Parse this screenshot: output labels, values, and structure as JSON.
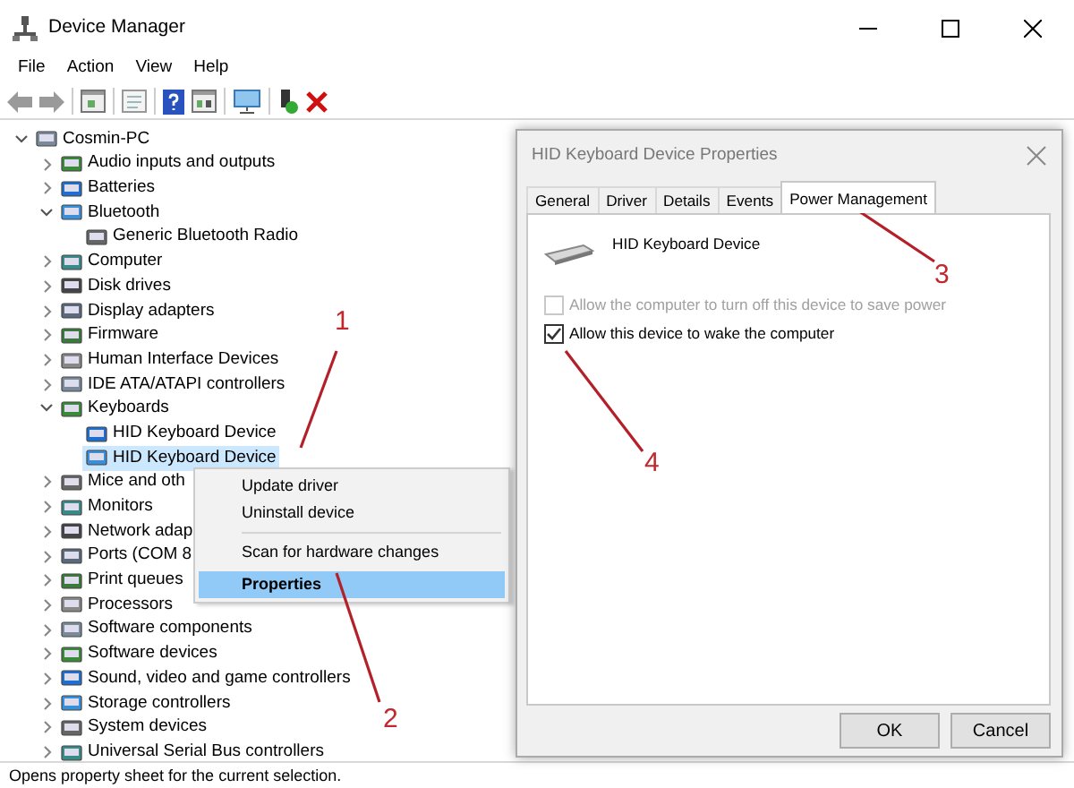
{
  "window": {
    "title": "Device Manager"
  },
  "menu": [
    "File",
    "Action",
    "View",
    "Help"
  ],
  "tree": {
    "label": "Cosmin-PC",
    "expanded": true,
    "selected": false,
    "children": [
      {
        "label": "Audio inputs and outputs",
        "expanded": false,
        "selected": false
      },
      {
        "label": "Batteries",
        "expanded": false,
        "selected": false
      },
      {
        "label": "Bluetooth",
        "expanded": true,
        "selected": false,
        "children": [
          {
            "label": "Generic Bluetooth Radio",
            "selected": false
          }
        ]
      },
      {
        "label": "Computer",
        "expanded": false,
        "selected": false
      },
      {
        "label": "Disk drives",
        "expanded": false,
        "selected": false
      },
      {
        "label": "Display adapters",
        "expanded": false,
        "selected": false
      },
      {
        "label": "Firmware",
        "expanded": false,
        "selected": false
      },
      {
        "label": "Human Interface Devices",
        "expanded": false,
        "selected": false
      },
      {
        "label": "IDE ATA/ATAPI controllers",
        "expanded": false,
        "selected": false
      },
      {
        "label": "Keyboards",
        "expanded": true,
        "selected": false,
        "children": [
          {
            "label": "HID Keyboard Device",
            "selected": false
          },
          {
            "label": "HID Keyboard Device",
            "selected": true
          }
        ]
      },
      {
        "label": "Mice and oth",
        "expanded": false,
        "selected": false
      },
      {
        "label": "Monitors",
        "expanded": false,
        "selected": false
      },
      {
        "label": "Network adap",
        "expanded": false,
        "selected": false
      },
      {
        "label": "Ports (COM 8",
        "expanded": false,
        "selected": false
      },
      {
        "label": "Print queues",
        "expanded": false,
        "selected": false
      },
      {
        "label": "Processors",
        "expanded": false,
        "selected": false
      },
      {
        "label": "Software components",
        "expanded": false,
        "selected": false
      },
      {
        "label": "Software devices",
        "expanded": false,
        "selected": false
      },
      {
        "label": "Sound, video and game controllers",
        "expanded": false,
        "selected": false
      },
      {
        "label": "Storage controllers",
        "expanded": false,
        "selected": false
      },
      {
        "label": "System devices",
        "expanded": false,
        "selected": false
      },
      {
        "label": "Universal Serial Bus controllers",
        "expanded": false,
        "selected": false
      }
    ]
  },
  "context_menu": [
    {
      "label": "Update driver",
      "selected": false,
      "separator_before": false
    },
    {
      "label": "Uninstall device",
      "selected": false,
      "separator_before": false
    },
    {
      "label": "Scan for hardware changes",
      "selected": false,
      "separator_before": true
    },
    {
      "label": "Properties",
      "selected": true,
      "separator_before": false
    }
  ],
  "dialog": {
    "title": "HID Keyboard Device Properties",
    "tabs": [
      {
        "label": "General",
        "selected": false
      },
      {
        "label": "Driver",
        "selected": false
      },
      {
        "label": "Details",
        "selected": false
      },
      {
        "label": "Events",
        "selected": false
      },
      {
        "label": "Power Management",
        "selected": true
      }
    ],
    "device_name": "HID Keyboard Device",
    "options": [
      {
        "label": "Allow the computer to turn off this device to save power",
        "checked": false,
        "disabled": true
      },
      {
        "label": "Allow this device to wake the computer",
        "checked": true,
        "disabled": false
      }
    ],
    "buttons": [
      "OK",
      "Cancel"
    ]
  },
  "annotations": [
    {
      "label": "1"
    },
    {
      "label": "2"
    },
    {
      "label": "3"
    },
    {
      "label": "4"
    }
  ],
  "status_bar": "Opens property sheet for the current selection."
}
